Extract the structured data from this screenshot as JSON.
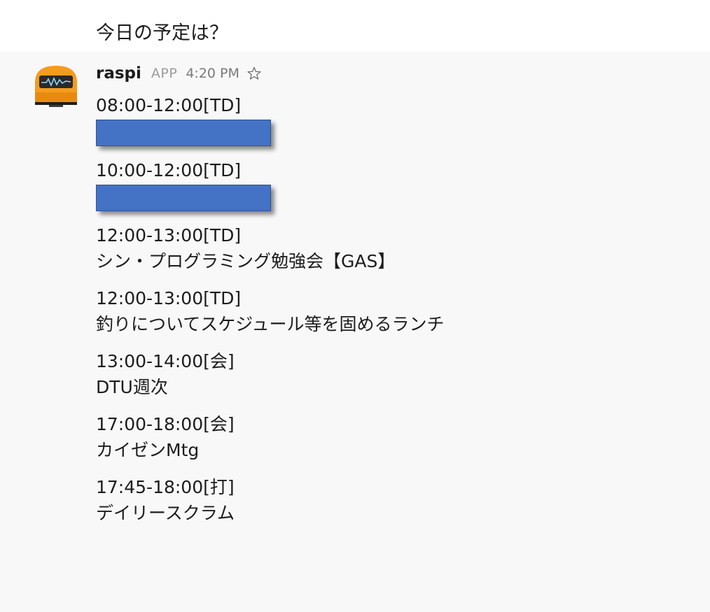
{
  "user_message": {
    "text": "今日の予定は？"
  },
  "bot_message": {
    "sender": "raspi",
    "badge": "APP",
    "time": "4:20 PM",
    "avatar_icon": "robot-avatar-icon",
    "star_icon": "star-outline-icon",
    "redaction_color": "#4472c4",
    "events": [
      {
        "time": "08:00-12:00[TD]",
        "title": "",
        "redacted": true
      },
      {
        "time": "10:00-12:00[TD]",
        "title": "",
        "redacted": true
      },
      {
        "time": "12:00-13:00[TD]",
        "title": "シン・プログラミング勉強会【GAS】",
        "redacted": false
      },
      {
        "time": "12:00-13:00[TD]",
        "title": "釣りについてスケジュール等を固めるランチ",
        "redacted": false
      },
      {
        "time": "13:00-14:00[会]",
        "title": "DTU週次",
        "redacted": false
      },
      {
        "time": "17:00-18:00[会]",
        "title": "カイゼンMtg",
        "redacted": false
      },
      {
        "time": "17:45-18:00[打]",
        "title": "デイリースクラム",
        "redacted": false
      }
    ]
  }
}
